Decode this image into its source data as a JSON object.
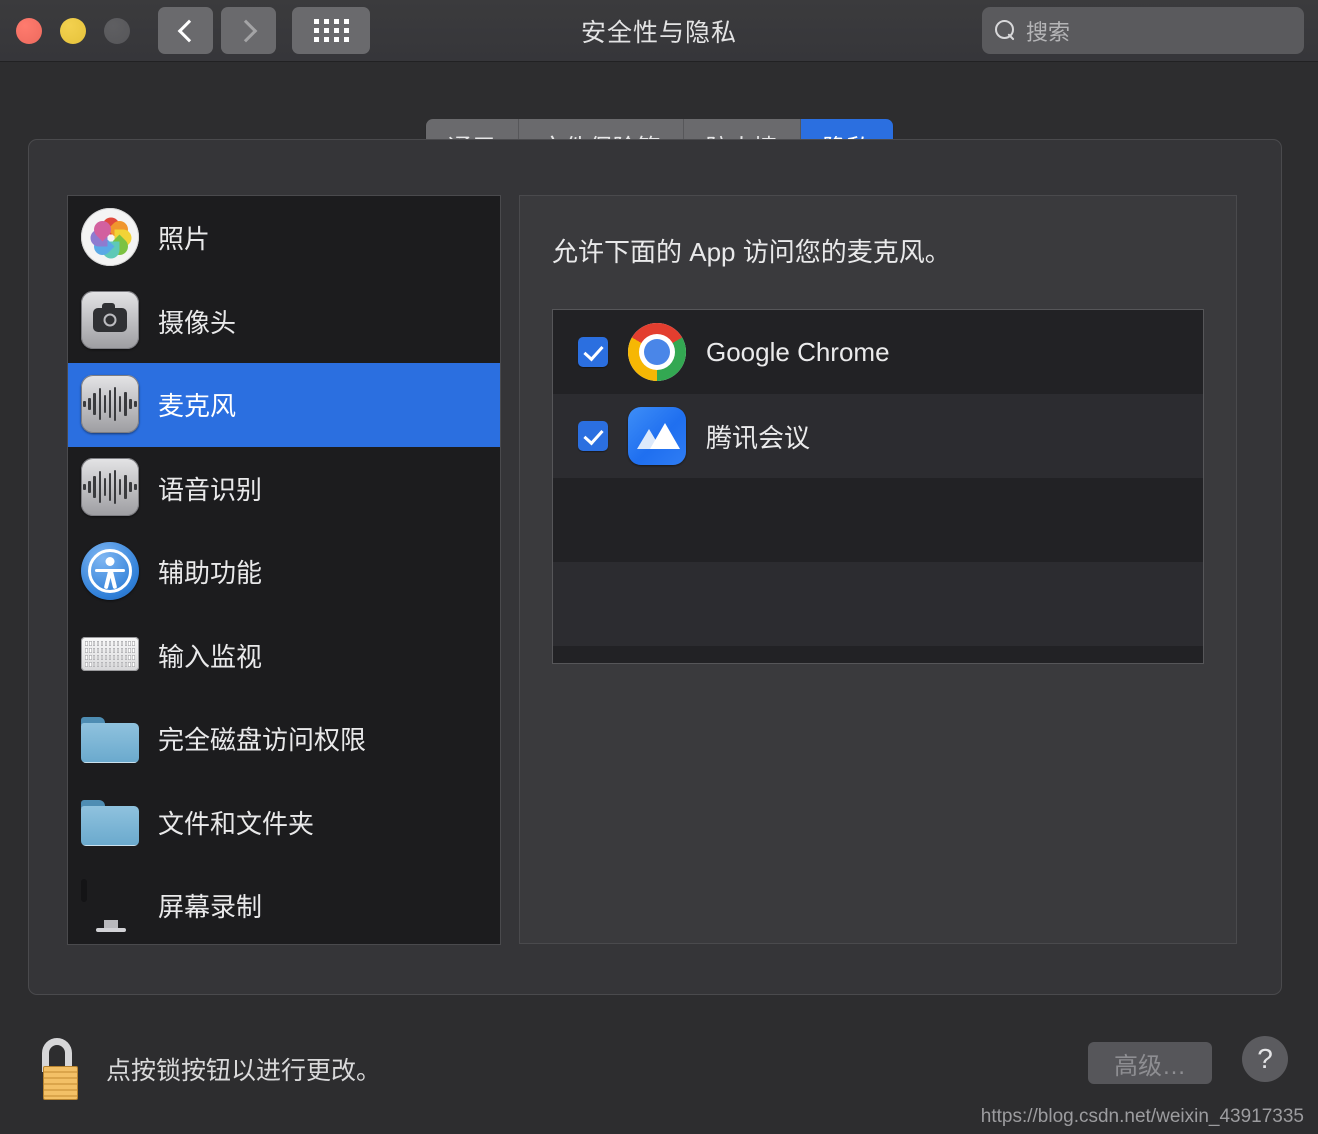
{
  "window": {
    "title": "安全性与隐私",
    "traffic_lights": [
      "close",
      "minimize",
      "zoom"
    ],
    "nav": {
      "back": "back-chevron",
      "forward": "forward-chevron",
      "grid": "show-all-grid"
    },
    "search": {
      "placeholder": "搜索",
      "value": "",
      "icon": "search-icon"
    }
  },
  "tabs": [
    {
      "label": "通用",
      "active": false
    },
    {
      "label": "文件保险箱",
      "active": false
    },
    {
      "label": "防火墙",
      "active": false
    },
    {
      "label": "隐私",
      "active": true
    }
  ],
  "sidebar": {
    "items": [
      {
        "label": "照片",
        "icon": "photos-icon",
        "selected": false
      },
      {
        "label": "摄像头",
        "icon": "camera-icon",
        "selected": false
      },
      {
        "label": "麦克风",
        "icon": "microphone-icon",
        "selected": true
      },
      {
        "label": "语音识别",
        "icon": "speech-icon",
        "selected": false
      },
      {
        "label": "辅助功能",
        "icon": "accessibility-icon",
        "selected": false
      },
      {
        "label": "输入监视",
        "icon": "keyboard-icon",
        "selected": false
      },
      {
        "label": "完全磁盘访问权限",
        "icon": "folder-icon",
        "selected": false
      },
      {
        "label": "文件和文件夹",
        "icon": "folder-icon",
        "selected": false
      },
      {
        "label": "屏幕录制",
        "icon": "display-icon",
        "selected": false
      }
    ]
  },
  "content": {
    "heading": "允许下面的 App 访问您的麦克风。",
    "apps": [
      {
        "name": "Google Chrome",
        "icon": "chrome-icon",
        "checked": true
      },
      {
        "name": "腾讯会议",
        "icon": "tencent-meeting-icon",
        "checked": true
      }
    ]
  },
  "bottom": {
    "lock_text": "点按锁按钮以进行更改。",
    "lock_icon": "unlocked-padlock-icon",
    "advanced_label": "高级…",
    "advanced_enabled": false,
    "help_label": "?"
  },
  "watermark": "https://blog.csdn.net/weixin_43917335",
  "colors": {
    "accent_blue": "#2b6fe0",
    "window_bg": "#2d2d2f",
    "panel_bg": "#353538",
    "list_bg": "#1c1c1e",
    "text": "#e9e9ea"
  }
}
